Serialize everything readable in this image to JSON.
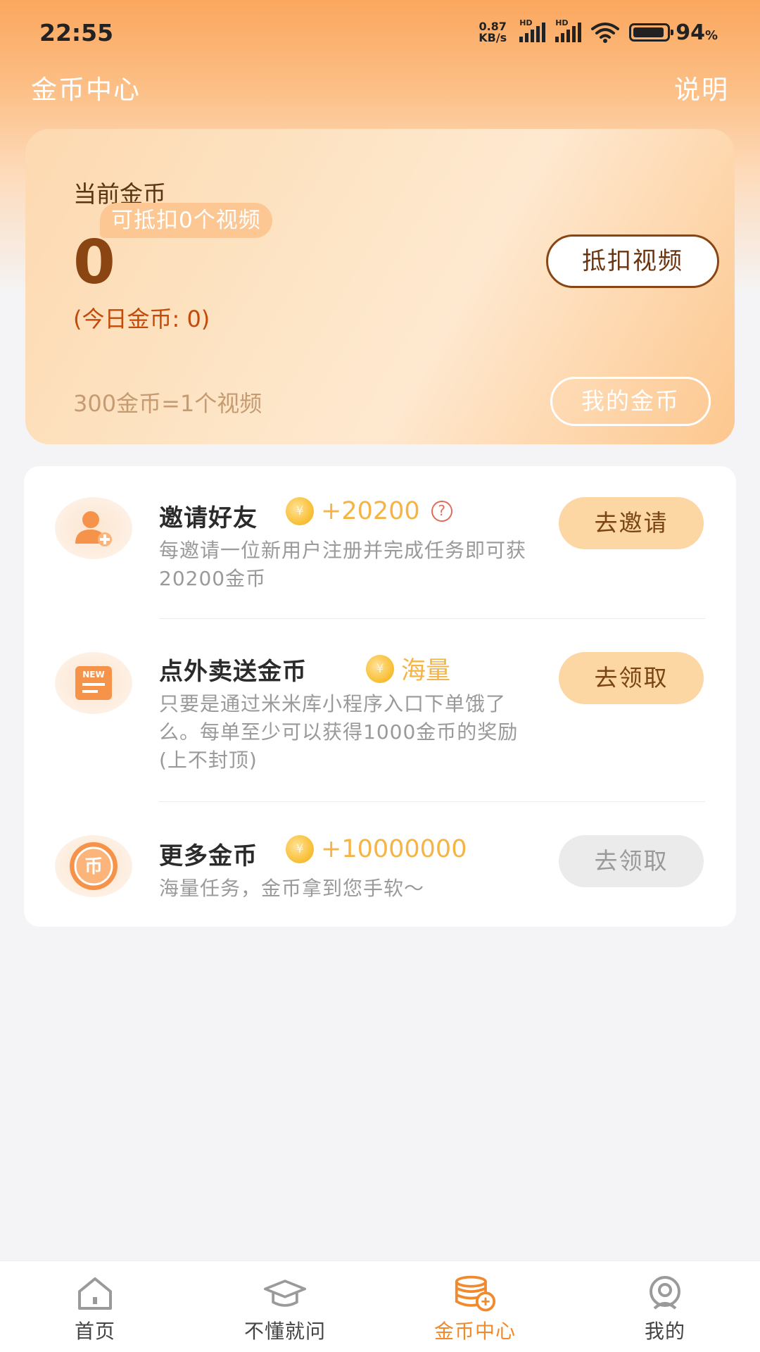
{
  "status_bar": {
    "time": "22:55",
    "net_speed_value": "0.87",
    "net_speed_unit": "KB/s",
    "signal1_label": "HD",
    "signal2_label": "HD",
    "battery_percent": "94",
    "battery_unit": "%",
    "battery_level": 0.94
  },
  "header": {
    "title": "金币中心",
    "help": "说明"
  },
  "coin_card": {
    "label": "当前金币",
    "badge": "可抵扣0个视频",
    "value": "0",
    "today": "(今日金币: 0)",
    "rate": "300金币=1个视频",
    "deduct_button": "抵扣视频",
    "my_coins_button": "我的金币"
  },
  "tasks": [
    {
      "title": "邀请好友",
      "reward": "+20200",
      "desc": "每邀请一位新用户注册并完成任务即可获20200金币",
      "button": "去邀请",
      "icon": "add-user-icon"
    },
    {
      "title": "点外卖送金币",
      "reward": "海量",
      "desc": "只要是通过米米库小程序入口下单饿了么。每单至少可以获得1000金币的奖励(上不封顶)",
      "button": "去领取",
      "icon": "new-document-icon"
    },
    {
      "title": "更多金币",
      "reward": "+10000000",
      "desc": "海量任务，金币拿到您手软～",
      "button": "去领取",
      "icon": "coin-icon"
    }
  ],
  "coin_symbol": "¥",
  "icon_text": {
    "new_badge": "NEW",
    "coin_char": "币",
    "help_mark": "?"
  },
  "bottom_nav": [
    {
      "label": "首页",
      "icon": "home-icon"
    },
    {
      "label": "不懂就问",
      "icon": "graduation-cap-icon"
    },
    {
      "label": "金币中心",
      "icon": "coin-stack-icon"
    },
    {
      "label": "我的",
      "icon": "profile-icon"
    }
  ],
  "colors": {
    "accent": "#f18a2c",
    "header_gradient_top": "#fba75e",
    "reward_gold": "#f5b445",
    "button_peach": "#fcd7a4",
    "coin_value_brown": "#8a4512"
  }
}
